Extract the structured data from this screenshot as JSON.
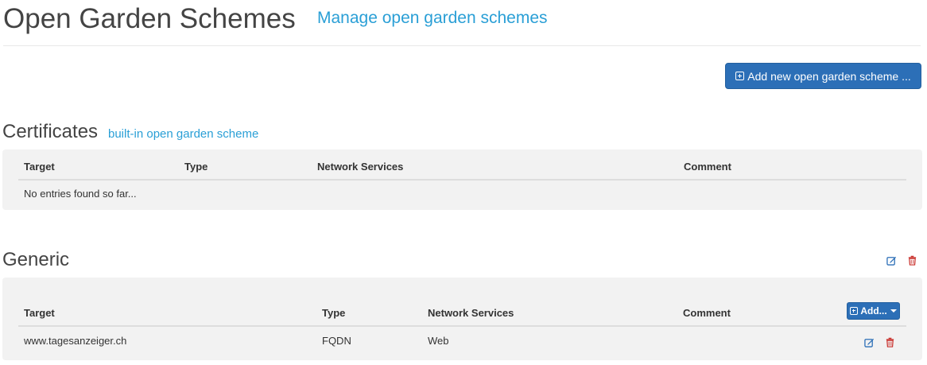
{
  "header": {
    "title": "Open Garden Schemes",
    "subtitle": "Manage open garden schemes"
  },
  "toolbar": {
    "add_scheme_label": "Add new open garden scheme ..."
  },
  "certificates": {
    "title": "Certificates",
    "subtitle": "built-in open garden scheme",
    "columns": [
      "Target",
      "Type",
      "Network Services",
      "Comment"
    ],
    "empty_text": "No entries found so far..."
  },
  "generic": {
    "title": "Generic",
    "columns": [
      "Target",
      "Type",
      "Network Services",
      "Comment"
    ],
    "add_label": "Add...",
    "rows": [
      {
        "target": "www.tagesanzeiger.ch",
        "type": "FQDN",
        "network_services": "Web",
        "comment": ""
      }
    ]
  },
  "colors": {
    "accent": "#2a9fd6",
    "primary_button": "#2c6fb7",
    "panel_bg": "#f2f2f2",
    "edit_icon": "#2c6fb7",
    "delete_icon": "#c9302c"
  },
  "icons": {
    "edit": "pencil-square-icon",
    "delete": "trash-icon",
    "add": "plus-square-icon",
    "caret": "caret-down-icon"
  }
}
